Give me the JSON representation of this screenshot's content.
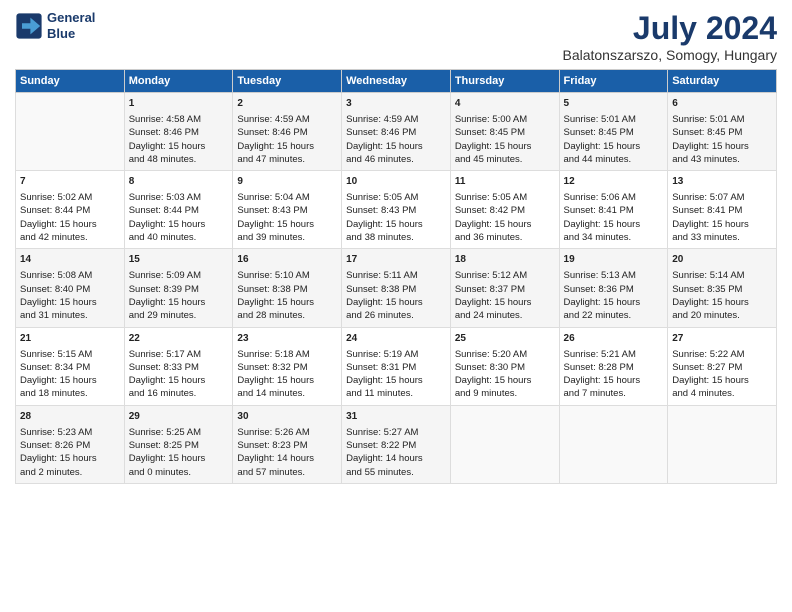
{
  "logo": {
    "line1": "General",
    "line2": "Blue"
  },
  "title": "July 2024",
  "subtitle": "Balatonszarszo, Somogy, Hungary",
  "days_of_week": [
    "Sunday",
    "Monday",
    "Tuesday",
    "Wednesday",
    "Thursday",
    "Friday",
    "Saturday"
  ],
  "weeks": [
    [
      {
        "day": "",
        "content": ""
      },
      {
        "day": "1",
        "content": "Sunrise: 4:58 AM\nSunset: 8:46 PM\nDaylight: 15 hours\nand 48 minutes."
      },
      {
        "day": "2",
        "content": "Sunrise: 4:59 AM\nSunset: 8:46 PM\nDaylight: 15 hours\nand 47 minutes."
      },
      {
        "day": "3",
        "content": "Sunrise: 4:59 AM\nSunset: 8:46 PM\nDaylight: 15 hours\nand 46 minutes."
      },
      {
        "day": "4",
        "content": "Sunrise: 5:00 AM\nSunset: 8:45 PM\nDaylight: 15 hours\nand 45 minutes."
      },
      {
        "day": "5",
        "content": "Sunrise: 5:01 AM\nSunset: 8:45 PM\nDaylight: 15 hours\nand 44 minutes."
      },
      {
        "day": "6",
        "content": "Sunrise: 5:01 AM\nSunset: 8:45 PM\nDaylight: 15 hours\nand 43 minutes."
      }
    ],
    [
      {
        "day": "7",
        "content": "Sunrise: 5:02 AM\nSunset: 8:44 PM\nDaylight: 15 hours\nand 42 minutes."
      },
      {
        "day": "8",
        "content": "Sunrise: 5:03 AM\nSunset: 8:44 PM\nDaylight: 15 hours\nand 40 minutes."
      },
      {
        "day": "9",
        "content": "Sunrise: 5:04 AM\nSunset: 8:43 PM\nDaylight: 15 hours\nand 39 minutes."
      },
      {
        "day": "10",
        "content": "Sunrise: 5:05 AM\nSunset: 8:43 PM\nDaylight: 15 hours\nand 38 minutes."
      },
      {
        "day": "11",
        "content": "Sunrise: 5:05 AM\nSunset: 8:42 PM\nDaylight: 15 hours\nand 36 minutes."
      },
      {
        "day": "12",
        "content": "Sunrise: 5:06 AM\nSunset: 8:41 PM\nDaylight: 15 hours\nand 34 minutes."
      },
      {
        "day": "13",
        "content": "Sunrise: 5:07 AM\nSunset: 8:41 PM\nDaylight: 15 hours\nand 33 minutes."
      }
    ],
    [
      {
        "day": "14",
        "content": "Sunrise: 5:08 AM\nSunset: 8:40 PM\nDaylight: 15 hours\nand 31 minutes."
      },
      {
        "day": "15",
        "content": "Sunrise: 5:09 AM\nSunset: 8:39 PM\nDaylight: 15 hours\nand 29 minutes."
      },
      {
        "day": "16",
        "content": "Sunrise: 5:10 AM\nSunset: 8:38 PM\nDaylight: 15 hours\nand 28 minutes."
      },
      {
        "day": "17",
        "content": "Sunrise: 5:11 AM\nSunset: 8:38 PM\nDaylight: 15 hours\nand 26 minutes."
      },
      {
        "day": "18",
        "content": "Sunrise: 5:12 AM\nSunset: 8:37 PM\nDaylight: 15 hours\nand 24 minutes."
      },
      {
        "day": "19",
        "content": "Sunrise: 5:13 AM\nSunset: 8:36 PM\nDaylight: 15 hours\nand 22 minutes."
      },
      {
        "day": "20",
        "content": "Sunrise: 5:14 AM\nSunset: 8:35 PM\nDaylight: 15 hours\nand 20 minutes."
      }
    ],
    [
      {
        "day": "21",
        "content": "Sunrise: 5:15 AM\nSunset: 8:34 PM\nDaylight: 15 hours\nand 18 minutes."
      },
      {
        "day": "22",
        "content": "Sunrise: 5:17 AM\nSunset: 8:33 PM\nDaylight: 15 hours\nand 16 minutes."
      },
      {
        "day": "23",
        "content": "Sunrise: 5:18 AM\nSunset: 8:32 PM\nDaylight: 15 hours\nand 14 minutes."
      },
      {
        "day": "24",
        "content": "Sunrise: 5:19 AM\nSunset: 8:31 PM\nDaylight: 15 hours\nand 11 minutes."
      },
      {
        "day": "25",
        "content": "Sunrise: 5:20 AM\nSunset: 8:30 PM\nDaylight: 15 hours\nand 9 minutes."
      },
      {
        "day": "26",
        "content": "Sunrise: 5:21 AM\nSunset: 8:28 PM\nDaylight: 15 hours\nand 7 minutes."
      },
      {
        "day": "27",
        "content": "Sunrise: 5:22 AM\nSunset: 8:27 PM\nDaylight: 15 hours\nand 4 minutes."
      }
    ],
    [
      {
        "day": "28",
        "content": "Sunrise: 5:23 AM\nSunset: 8:26 PM\nDaylight: 15 hours\nand 2 minutes."
      },
      {
        "day": "29",
        "content": "Sunrise: 5:25 AM\nSunset: 8:25 PM\nDaylight: 15 hours\nand 0 minutes."
      },
      {
        "day": "30",
        "content": "Sunrise: 5:26 AM\nSunset: 8:23 PM\nDaylight: 14 hours\nand 57 minutes."
      },
      {
        "day": "31",
        "content": "Sunrise: 5:27 AM\nSunset: 8:22 PM\nDaylight: 14 hours\nand 55 minutes."
      },
      {
        "day": "",
        "content": ""
      },
      {
        "day": "",
        "content": ""
      },
      {
        "day": "",
        "content": ""
      }
    ]
  ]
}
